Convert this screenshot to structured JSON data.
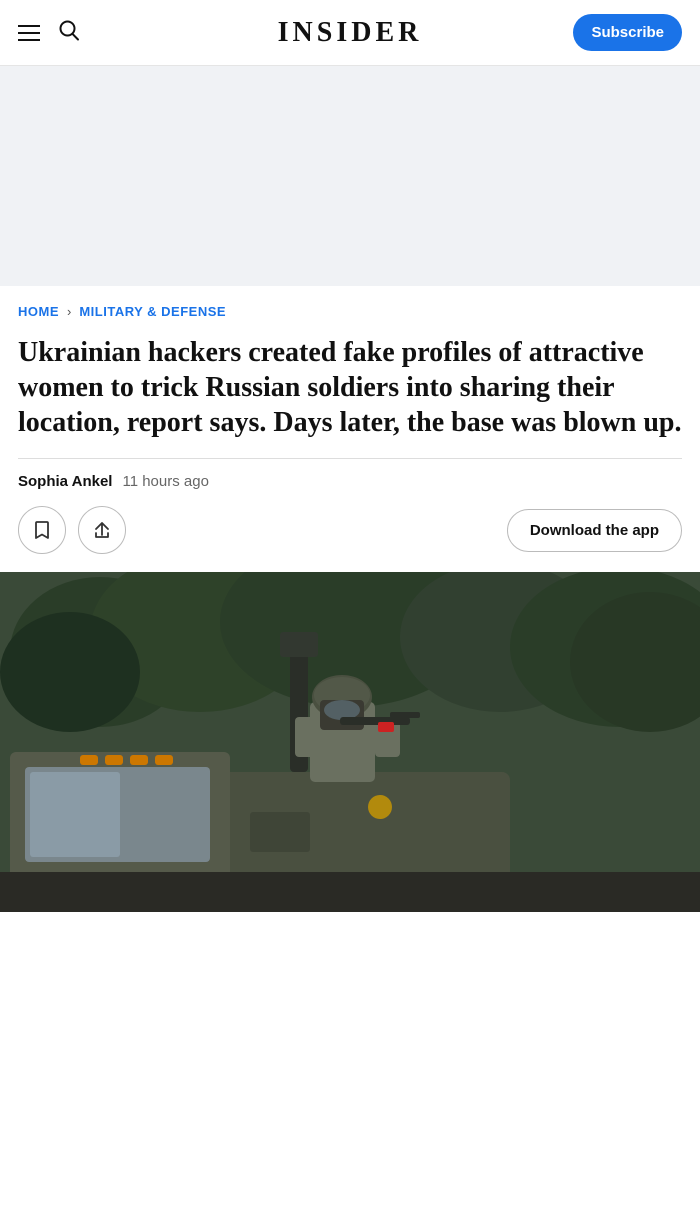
{
  "header": {
    "title": "INSIDER",
    "subscribe_label": "Subscribe"
  },
  "ad_banner": {
    "aria_label": "Advertisement"
  },
  "breadcrumb": {
    "home": "HOME",
    "separator": "›",
    "section": "MILITARY & DEFENSE"
  },
  "article": {
    "title": "Ukrainian hackers created fake profiles of attractive women to trick Russian soldiers into sharing their location, report says. Days later, the base was blown up.",
    "author": "Sophia Ankel",
    "time_ago": "11 hours ago"
  },
  "actions": {
    "bookmark_label": "Bookmark",
    "share_label": "Share",
    "download_app_label": "Download the app"
  }
}
